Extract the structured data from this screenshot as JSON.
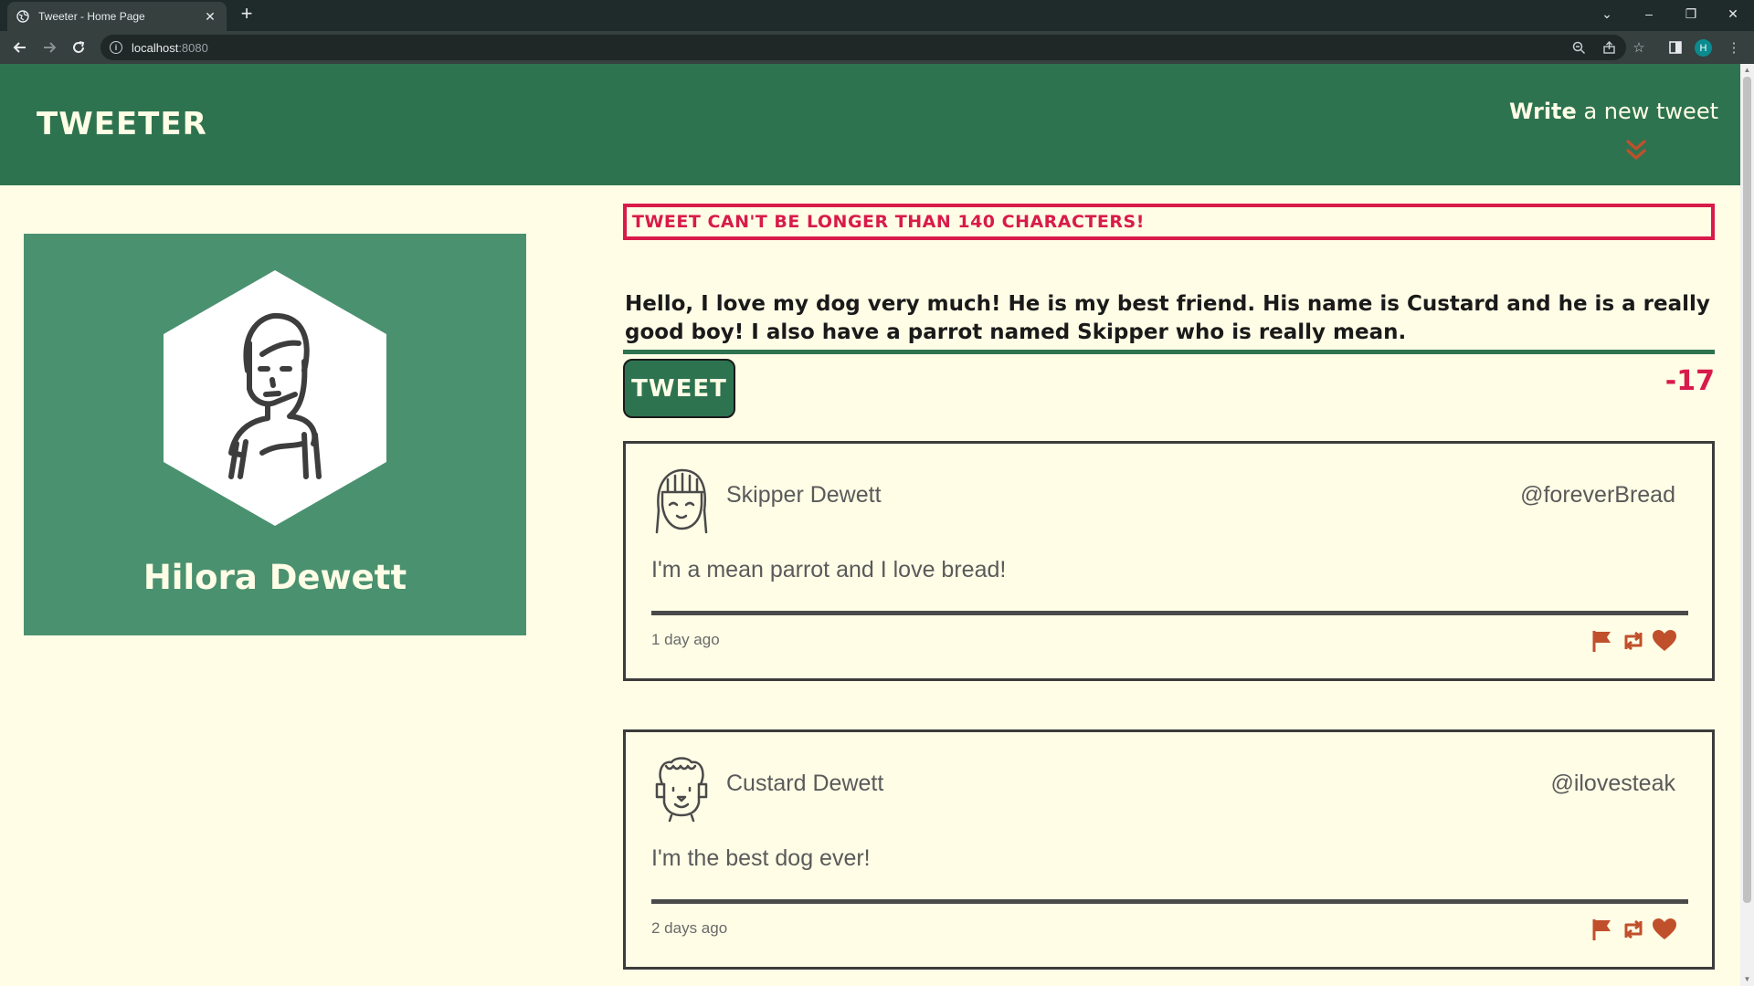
{
  "browser": {
    "tab_title": "Tweeter - Home Page",
    "url_host": "localhost",
    "url_port": ":8080",
    "profile_initial": "H"
  },
  "colors": {
    "header_green": "#2e7350",
    "card_green": "#4a9170",
    "cream": "#fffde6",
    "error_red": "#d81b4a",
    "action_orange": "#c0502c"
  },
  "header": {
    "brand": "TWEETER",
    "compose_bold": "Write",
    "compose_rest": " a new tweet",
    "compose_icon": "double-chevron-down-icon"
  },
  "profile": {
    "name": "Hilora Dewett"
  },
  "composer": {
    "error": "Tweet can't be longer than 140 characters!",
    "text": "Hello, I love my dog very much! He is my best friend. His name is Custard and he is a really good boy! I also have a parrot named Skipper who is really mean.",
    "button_label": "TWEET",
    "counter": "-17"
  },
  "tweets": [
    {
      "name": "Skipper Dewett",
      "handle": "@foreverBread",
      "body": "I'm a mean parrot and I love bread!",
      "time": "1 day ago"
    },
    {
      "name": "Custard Dewett",
      "handle": "@ilovesteak",
      "body": "I'm the best dog ever!",
      "time": "2 days ago"
    }
  ]
}
